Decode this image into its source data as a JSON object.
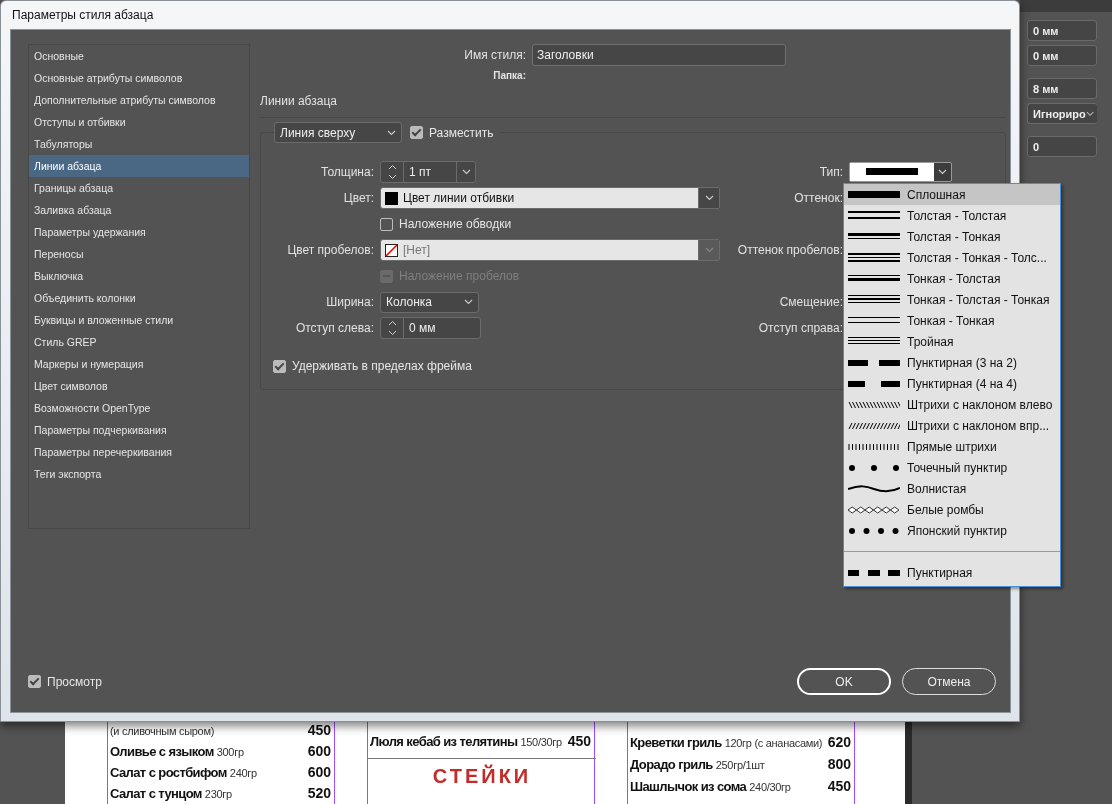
{
  "dialog": {
    "title": "Параметры стиля абзаца",
    "categories": [
      {
        "label": "Основные",
        "selected": false
      },
      {
        "label": "Основные атрибуты символов",
        "selected": false
      },
      {
        "label": "Дополнительные атрибуты символов",
        "selected": false
      },
      {
        "label": "Отступы и отбивки",
        "selected": false
      },
      {
        "label": "Табуляторы",
        "selected": false
      },
      {
        "label": "Линии абзаца",
        "selected": true
      },
      {
        "label": "Границы абзаца",
        "selected": false
      },
      {
        "label": "Заливка абзаца",
        "selected": false
      },
      {
        "label": "Параметры удержания",
        "selected": false
      },
      {
        "label": "Переносы",
        "selected": false
      },
      {
        "label": "Выключка",
        "selected": false
      },
      {
        "label": "Объединить колонки",
        "selected": false
      },
      {
        "label": "Буквицы и вложенные стили",
        "selected": false
      },
      {
        "label": "Стиль GREP",
        "selected": false
      },
      {
        "label": "Маркеры и нумерация",
        "selected": false
      },
      {
        "label": "Цвет символов",
        "selected": false
      },
      {
        "label": "Возможности OpenType",
        "selected": false
      },
      {
        "label": "Параметры подчеркивания",
        "selected": false
      },
      {
        "label": "Параметры перечеркивания",
        "selected": false
      },
      {
        "label": "Теги экспорта",
        "selected": false
      }
    ],
    "style_name": {
      "label": "Имя стиля:",
      "value": "Заголовки"
    },
    "folder_label": "Папка:",
    "section_title": "Линии абзаца",
    "rule_select": "Линия сверху",
    "rule_on": {
      "label": "Разместить",
      "checked": true
    },
    "rows": [
      {
        "kind": "spinner-select",
        "label": "Толщина:",
        "value": "1 пт"
      },
      {
        "kind": "color-select",
        "label": "Цвет:",
        "value": "Цвет линии отбивки",
        "disabled": false,
        "side_label": "Оттенок:"
      },
      {
        "kind": "checkbox",
        "label": "Наложение обводки",
        "checked": false,
        "disabled": false
      },
      {
        "kind": "no-color-select",
        "label": "Цвет пробелов:",
        "value": "[Нет]",
        "disabled": true,
        "side_label": "Оттенок пробелов:"
      },
      {
        "kind": "checkbox",
        "label": "Наложение пробелов",
        "checked": false,
        "disabled": true
      },
      {
        "kind": "select",
        "label": "Ширина:",
        "value": "Колонка",
        "side_label": "Смещение:"
      },
      {
        "kind": "spinner",
        "label": "Отступ слева:",
        "value": "0 мм",
        "side_label": "Отступ справа:"
      }
    ],
    "type_select": {
      "label": "Тип:",
      "expanded": true,
      "options": [
        {
          "label": "Сплошная",
          "selected": true
        },
        {
          "label": "Толстая - Толстая",
          "selected": false
        },
        {
          "label": "Толстая - Тонкая",
          "selected": false
        },
        {
          "label": "Толстая - Тонкая - Толс...",
          "selected": false
        },
        {
          "label": "Тонкая - Толстая",
          "selected": false
        },
        {
          "label": "Тонкая - Толстая - Тонкая",
          "selected": false
        },
        {
          "label": "Тонкая - Тонкая",
          "selected": false
        },
        {
          "label": "Тройная",
          "selected": false
        },
        {
          "label": "Пунктирная (3 на 2)",
          "selected": false
        },
        {
          "label": "Пунктирная (4 на 4)",
          "selected": false
        },
        {
          "label": "Штрихи с наклоном влево",
          "selected": false
        },
        {
          "label": "Штрихи с наклоном впр...",
          "selected": false
        },
        {
          "label": "Прямые штрихи",
          "selected": false
        },
        {
          "label": "Точечный пунктир",
          "selected": false
        },
        {
          "label": "Волнистая",
          "selected": false
        },
        {
          "label": "Белые ромбы",
          "selected": false
        },
        {
          "label": "Японский пунктир",
          "selected": false
        }
      ],
      "custom_options": [
        {
          "label": "Пунктирная",
          "selected": false
        }
      ]
    },
    "keep_in_frame": {
      "label": "Удерживать в пределах фрейма",
      "checked": true
    },
    "preview": {
      "label": "Просмотр",
      "checked": true
    },
    "buttons": [
      {
        "label": "OK",
        "default": true
      },
      {
        "label": "Отмена",
        "default": false
      }
    ]
  },
  "panel_fields": [
    {
      "kind": "field",
      "value": "0 мм"
    },
    {
      "kind": "field",
      "value": "0 мм"
    },
    {
      "kind": "field",
      "value": "8 мм"
    },
    {
      "kind": "select",
      "value": "Игнориро"
    },
    {
      "kind": "field",
      "value": "0"
    }
  ],
  "document": {
    "columns": [
      {
        "rows": [
          {
            "detail": "(и сливочным сыром)",
            "price": "450"
          },
          {
            "name": "Оливье с языком",
            "detail": "300гр",
            "price": "600"
          },
          {
            "name": "Салат с ростбифом",
            "detail": "240гр",
            "price": "600"
          },
          {
            "name": "Салат с тунцом",
            "detail": "230гр",
            "price": "520"
          }
        ]
      },
      {
        "rows": [
          {
            "name": "Люля кебаб из телятины",
            "detail": "150/30гр",
            "price": "450"
          }
        ],
        "heading": "СТЕЙКИ"
      },
      {
        "rows": [
          {
            "name": "Креветки гриль",
            "detail": "120гр (с ананасами)",
            "price": "620"
          },
          {
            "name": "Дорадо гриль",
            "detail": "250гр/1шт",
            "price": "800"
          },
          {
            "name": "Шашлычок из сома",
            "detail": "240/30гр",
            "price": "450"
          }
        ]
      }
    ]
  }
}
